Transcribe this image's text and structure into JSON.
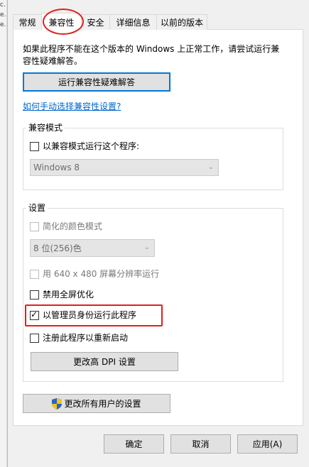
{
  "background_window": {
    "left_edge_glyphs": [
      "c.",
      "e.",
      "e."
    ]
  },
  "tabs": [
    {
      "label": "常规"
    },
    {
      "label": "兼容性"
    },
    {
      "label": "安全"
    },
    {
      "label": "详细信息"
    },
    {
      "label": "以前的版本"
    }
  ],
  "active_tab": "兼容性",
  "intro": {
    "line1": "如果此程序不能在这个版本的 Windows 上正常工作，请尝试运行兼",
    "line2": "容性疑难解答。"
  },
  "buttons": {
    "run_troubleshooter": "运行兼容性疑难解答",
    "change_dpi": "更改高 DPI 设置",
    "change_all_users": "更改所有用户的设置",
    "ok": "确定",
    "cancel": "取消",
    "apply": "应用(A)"
  },
  "manual_link": "如何手动选择兼容性设置?",
  "compat_mode": {
    "legend": "兼容模式",
    "checkbox_label": "以兼容模式运行这个程序:",
    "checked": false,
    "os_select": "Windows 8"
  },
  "settings": {
    "legend": "设置",
    "reduced_color": {
      "label": "简化的颜色模式",
      "checked": false,
      "enabled": false
    },
    "color_select": "8 位(256)色",
    "run_640": {
      "label": "用 640 x 480 屏幕分辨率运行",
      "checked": false,
      "enabled": false
    },
    "disable_fullscreen": {
      "label": "禁用全屏优化",
      "checked": false,
      "enabled": true
    },
    "run_as_admin": {
      "label": "以管理员身份运行此程序",
      "checked": true,
      "enabled": true
    },
    "register_restart": {
      "label": "注册此程序以重新启动",
      "checked": false,
      "enabled": true
    }
  },
  "colors": {
    "annotation": "#e0201b",
    "link": "#0066cc",
    "focus": "#0078d7"
  }
}
